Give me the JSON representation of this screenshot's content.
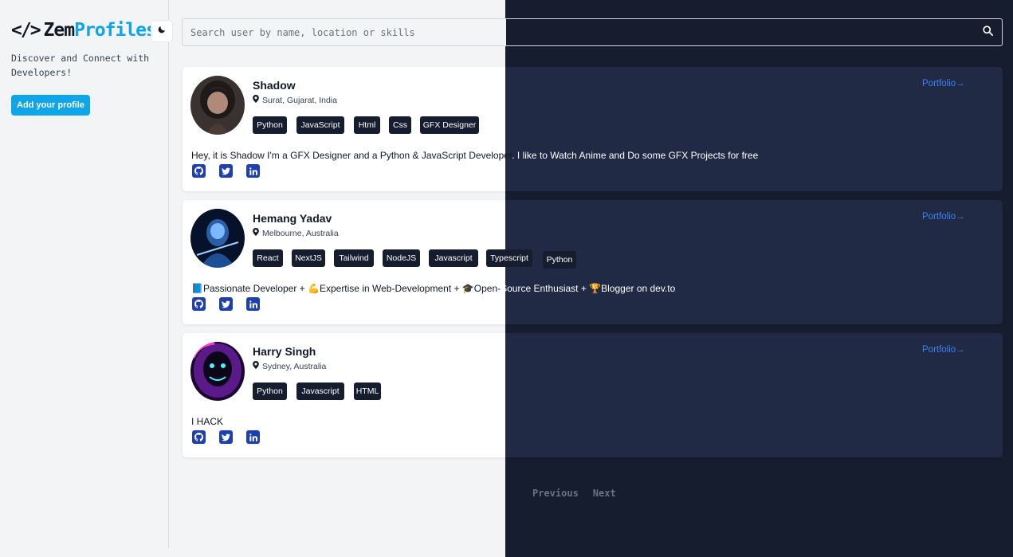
{
  "brand": {
    "logo_icon": "</>",
    "name_part1": "Zem",
    "name_part2": "Profiles",
    "tagline": "Discover and Connect with Developers!",
    "accent_color": "#0ea5e9"
  },
  "sidebar": {
    "theme_toggle_icon": "moon-icon",
    "add_profile_label": "Add your profile"
  },
  "search": {
    "placeholder": "Search user by name, location or skills",
    "value": "",
    "icon": "search-icon"
  },
  "profiles": [
    {
      "name": "Shadow",
      "location": "Surat, Gujarat, India",
      "tags": [
        "Python",
        "JavaScript",
        "Html",
        "Css",
        "GFX Designer"
      ],
      "bio_light": "Hey, it is Shadow I'm a GFX Designer and a Python & JavaScript Developer",
      "bio_dark": ". I like to Watch Anime and Do some GFX Projects for free",
      "portfolio_label": "Portfolio→",
      "socials": [
        "github-icon",
        "twitter-icon",
        "linkedin-icon"
      ]
    },
    {
      "name": "Hemang Yadav",
      "location": "Melbourne, Australia",
      "tags": [
        "React",
        "NextJS",
        "Tailwind",
        "NodeJS",
        "Javascript",
        "Typescript",
        "Python"
      ],
      "bio_light": "📘Passionate Developer + 💪Expertise in Web-Development + 🎓Open-",
      "bio_dark": "Source Enthusiast + 🏆Blogger on dev.to",
      "portfolio_label": "Portfolio→",
      "socials": [
        "github-icon",
        "twitter-icon",
        "linkedin-icon"
      ]
    },
    {
      "name": "Harry Singh",
      "location": "Sydney, Australia",
      "tags": [
        "Python",
        "Javascript",
        "HTML"
      ],
      "bio_light": "I HACK",
      "bio_dark": "",
      "portfolio_label": "Portfolio→",
      "socials": [
        "github-icon",
        "twitter-icon",
        "linkedin-icon"
      ]
    }
  ],
  "pagination": {
    "previous_label": "Previous",
    "next_label": "Next"
  },
  "colors": {
    "light_bg": "#f3f4f6",
    "dark_bg": "#151d2e",
    "dark_card": "#202a44",
    "tag_bg": "#151d2e",
    "link": "#3b82f6",
    "social": "#1e40af"
  }
}
